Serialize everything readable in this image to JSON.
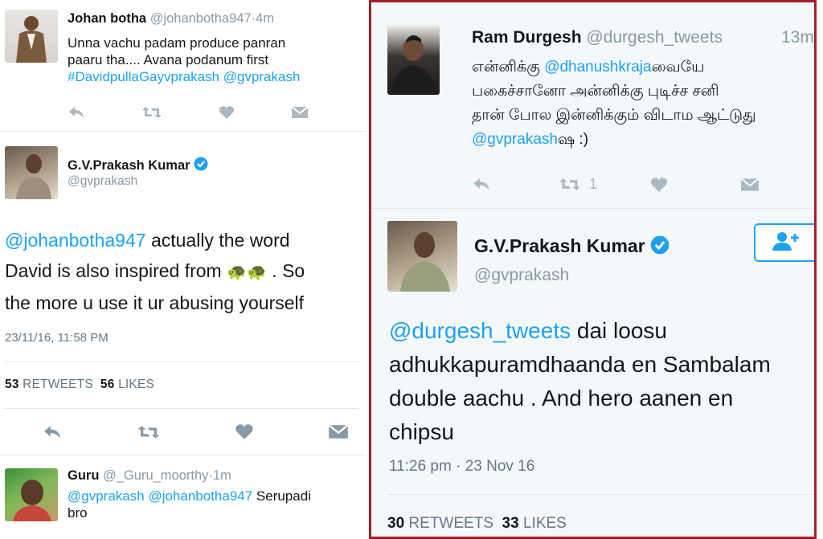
{
  "left_panel": {
    "tweet1": {
      "name": "Johan botha",
      "handle": "@johanbotha947",
      "sep": "·",
      "time": "4m",
      "line1": "Unna vachu padam produce panran",
      "line2": "paaru tha.... Avana podanum first",
      "hashtag": "#DavidpullaGayvprakash",
      "mention": "@gvprakash"
    },
    "tweet2": {
      "name": "G.V.Prakash Kumar",
      "handle": "@gvprakash",
      "mention": "@johanbotha947",
      "text1": " actually the word",
      "text2a": "David is also inspired from ",
      "emoji": "🐢🐢",
      "text2b": " . So",
      "text3": "the more u use it ur abusing yourself",
      "timestamp": "23/11/16, 11:58 PM",
      "retweets_count": "53",
      "retweets_label": "RETWEETS",
      "likes_count": "56",
      "likes_label": "LIKES"
    },
    "tweet3": {
      "name": "Guru",
      "handle": "@_Guru_moorthy",
      "sep": "·",
      "time": "1m",
      "mention1": "@gvprakash",
      "mention2": "@johanbotha947",
      "text1": " Serupadi",
      "text2": "bro"
    }
  },
  "right_panel": {
    "tweet1": {
      "name": "Ram Durgesh",
      "handle": "@durgesh_tweets",
      "time": "13m",
      "line1a": "என்னிக்கு ",
      "mention": "@dhanushkraja",
      "line1b": "வையே",
      "line2": "பகைச்சானோ அன்னிக்கு புடிச்ச சனி",
      "line3": "தான் போல இன்னிக்கும் விடாம ஆட்டுது",
      "mention2": "@gvprakash",
      "line4b": "ஷ :)",
      "retweet_count": "1"
    },
    "tweet2": {
      "name": "G.V.Prakash Kumar",
      "handle": "@gvprakash",
      "mention": "@durgesh_tweets",
      "text1": " dai loosu",
      "text2": "adhukkapuramdhaanda en Sambalam",
      "text3": "double aachu . And hero aanen en",
      "text4": "chipsu",
      "timestamp": "11:26 pm · 23 Nov 16",
      "retweets_count": "30",
      "retweets_label": "RETWEETS",
      "likes_count": "33",
      "likes_label": "LIKES"
    }
  },
  "icons": [
    "reply-icon",
    "retweet-icon",
    "like-icon",
    "message-icon",
    "verified-icon",
    "follow-icon"
  ],
  "colors": {
    "link": "#1da1f2",
    "frame": "#a61e2a",
    "muted": "#8899a6"
  }
}
